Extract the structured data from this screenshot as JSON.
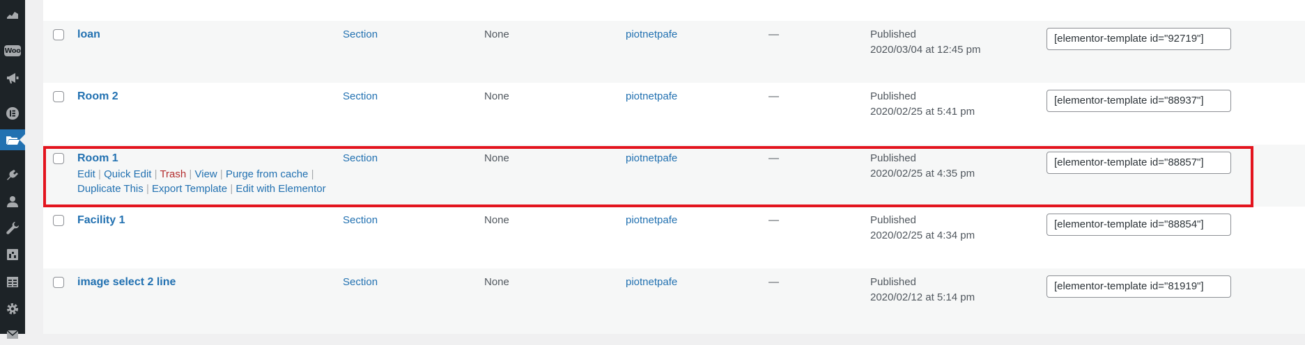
{
  "sidebar": {
    "icons": [
      {
        "name": "dashboard-icon"
      },
      {
        "name": "woocommerce-icon",
        "label": "Woo"
      },
      {
        "name": "megaphone-icon"
      },
      {
        "name": "elementor-icon"
      },
      {
        "name": "templates-folder-icon",
        "active": true
      },
      {
        "name": "plugins-icon"
      },
      {
        "name": "users-icon"
      },
      {
        "name": "tools-icon"
      },
      {
        "name": "add-ons-icon"
      },
      {
        "name": "calendar-table-icon"
      },
      {
        "name": "settings-gear-icon"
      },
      {
        "name": "mail-icon"
      }
    ]
  },
  "rows": [
    {
      "title": "loan",
      "type": "Section",
      "instances": "None",
      "author": "piotnetpafe",
      "categories": "—",
      "status": "Published",
      "date": "2020/03/04 at 12:45 pm",
      "shortcode": "[elementor-template id=\"92719\"]"
    },
    {
      "title": "Room 2",
      "type": "Section",
      "instances": "None",
      "author": "piotnetpafe",
      "categories": "—",
      "status": "Published",
      "date": "2020/02/25 at 5:41 pm",
      "shortcode": "[elementor-template id=\"88937\"]"
    },
    {
      "title": "Room 1",
      "type": "Section",
      "instances": "None",
      "author": "piotnetpafe",
      "categories": "—",
      "status": "Published",
      "date": "2020/02/25 at 4:35 pm",
      "shortcode": "[elementor-template id=\"88857\"]",
      "actions": {
        "edit": "Edit",
        "quick_edit": "Quick Edit",
        "trash": "Trash",
        "view": "View",
        "purge": "Purge from cache",
        "duplicate": "Duplicate This",
        "export": "Export Template",
        "edit_elementor": "Edit with Elementor",
        "separator": "|"
      }
    },
    {
      "title": "Facility 1",
      "type": "Section",
      "instances": "None",
      "author": "piotnetpafe",
      "categories": "—",
      "status": "Published",
      "date": "2020/02/25 at 4:34 pm",
      "shortcode": "[elementor-template id=\"88854\"]"
    },
    {
      "title": "image select 2 line",
      "type": "Section",
      "instances": "None",
      "author": "piotnetpafe",
      "categories": "—",
      "status": "Published",
      "date": "2020/02/12 at 5:14 pm",
      "shortcode": "[elementor-template id=\"81919\"]"
    }
  ],
  "colors": {
    "link": "#2271b1",
    "trash": "#b32d2e",
    "highlight_border": "#e3141e",
    "sidebar_bg": "#1d2327",
    "sidebar_active": "#2271b1"
  }
}
